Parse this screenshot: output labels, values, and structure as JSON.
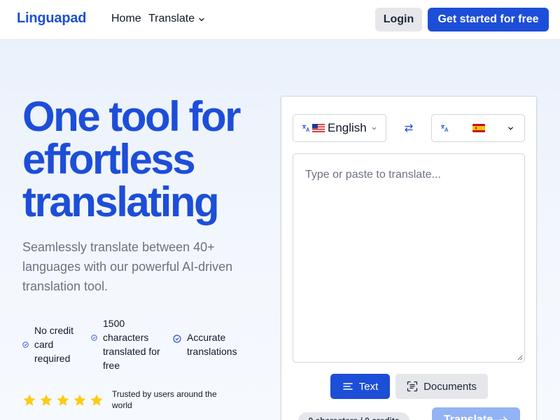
{
  "header": {
    "logo": "Linguapad",
    "nav": {
      "home": "Home",
      "translate": "Translate"
    },
    "login_label": "Login",
    "get_started_label": "Get started for free"
  },
  "hero": {
    "title": "One tool for effortless translating",
    "subtitle": "Seamlessly translate between 40+ languages with our powerful AI-driven translation tool.",
    "features": [
      {
        "text": "No credit card required"
      },
      {
        "text": "1500 characters translated for free"
      },
      {
        "text": "Accurate translations"
      }
    ],
    "rating_stars": 5,
    "trusted_text": "Trusted by users around the world"
  },
  "translator": {
    "source_language": "English",
    "target_language": "",
    "placeholder": "Type or paste to translate...",
    "text_mode_label": "Text",
    "documents_mode_label": "Documents",
    "counter": "0 characters / 0 credits",
    "translate_label": "Translate"
  },
  "colors": {
    "brand": "#1d4ed8",
    "star": "#facc15",
    "button_gray": "#e5e7eb",
    "translate_disabled": "#93b4f4"
  },
  "icons": {
    "nav_translate": "chevron-down-icon",
    "feature": "check-circle-icon",
    "rating": "star-icon",
    "swap": "swap-arrows-icon",
    "language": "translate-icon",
    "text_mode": "text-lines-icon",
    "documents_mode": "document-scan-icon",
    "translate_button": "arrow-right-icon"
  }
}
